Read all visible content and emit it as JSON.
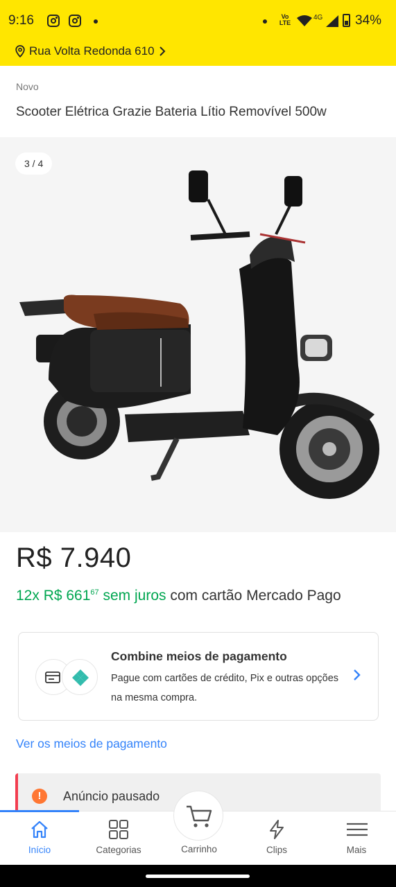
{
  "status_bar": {
    "time": "9:16",
    "network": "4G",
    "volte": "Vo LTE",
    "battery": "34%"
  },
  "location": {
    "address": "Rua Volta Redonda 610"
  },
  "product": {
    "condition": "Novo",
    "title": "Scooter Elétrica Grazie Bateria Lítio Removível 500w",
    "image_counter": "3 / 4",
    "price": "R$ 7.940",
    "installments_green": "12x R$ 661",
    "installments_cents": "67",
    "installments_green_suffix": " sem juros",
    "installments_rest": " com cartão Mercado Pago"
  },
  "payment_card": {
    "title": "Combine meios de pagamento",
    "description": "Pague com cartões de crédito, Pix e outras opções na mesma compra."
  },
  "payment_link": "Ver os meios de pagamento",
  "notice": {
    "icon_glyph": "!",
    "text": "Anúncio pausado"
  },
  "bottom_nav": {
    "items": [
      {
        "label": "Início",
        "icon": "home-icon"
      },
      {
        "label": "Categorias",
        "icon": "grid-icon"
      },
      {
        "label": "Carrinho",
        "icon": "cart-icon"
      },
      {
        "label": "Clips",
        "icon": "lightning-icon"
      },
      {
        "label": "Mais",
        "icon": "menu-icon"
      }
    ]
  },
  "colors": {
    "brand_yellow": "#ffe600",
    "accent_blue": "#3483fa",
    "green": "#00a650",
    "warning": "#ff7733"
  }
}
